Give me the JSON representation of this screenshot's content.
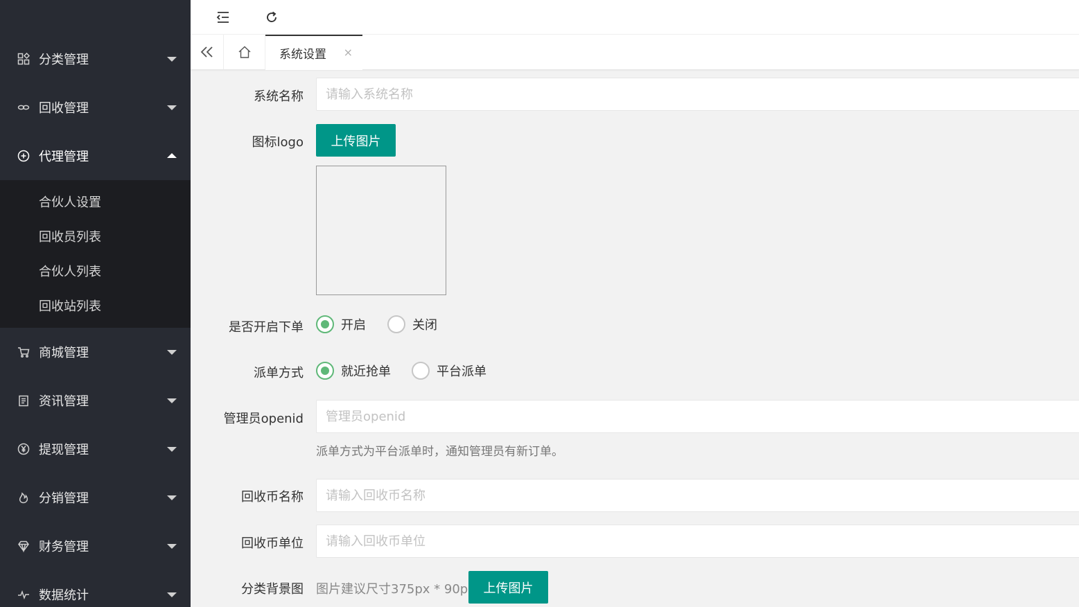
{
  "sidebar": {
    "items": [
      {
        "label": "分类管理",
        "icon": "category-grid-icon"
      },
      {
        "label": "回收管理",
        "icon": "infinity-link-icon"
      },
      {
        "label": "代理管理",
        "icon": "plus-circle-icon"
      },
      {
        "label": "商城管理",
        "icon": "cart-icon"
      },
      {
        "label": "资讯管理",
        "icon": "clipboard-icon"
      },
      {
        "label": "提现管理",
        "icon": "yen-circle-icon"
      },
      {
        "label": "分销管理",
        "icon": "flame-icon"
      },
      {
        "label": "财务管理",
        "icon": "diamond-icon"
      },
      {
        "label": "数据统计",
        "icon": "pulse-icon"
      }
    ],
    "submenu": [
      "合伙人设置",
      "回收员列表",
      "合伙人列表",
      "回收站列表"
    ]
  },
  "topbar": {
    "menu_icon": "menu-fold-icon",
    "refresh_icon": "refresh-icon"
  },
  "tabs": {
    "active": "系统设置",
    "close": "×"
  },
  "form": {
    "system_name_label": "系统名称",
    "system_name_placeholder": "请输入系统名称",
    "logo_label": "图标logo",
    "upload_label": "上传图片",
    "order_label": "是否开启下单",
    "order_on": "开启",
    "order_off": "关闭",
    "dispatch_label": "派单方式",
    "dispatch_near": "就近抢单",
    "dispatch_platform": "平台派单",
    "openid_label": "管理员openid",
    "openid_placeholder": "管理员openid",
    "openid_hint": "派单方式为平台派单时，通知管理员有新订单。",
    "coin_name_label": "回收币名称",
    "coin_name_placeholder": "请输入回收币名称",
    "coin_unit_label": "回收币单位",
    "coin_unit_placeholder": "请输入回收币单位",
    "bg_label": "分类背景图",
    "bg_hint": "图片建议尺寸375px * 90px",
    "bg_upload_label": "上传图片"
  },
  "colors": {
    "sidebar": "#282b33",
    "submenu": "#1c1d21",
    "primary": "#009688",
    "radio": "#5fb878"
  }
}
